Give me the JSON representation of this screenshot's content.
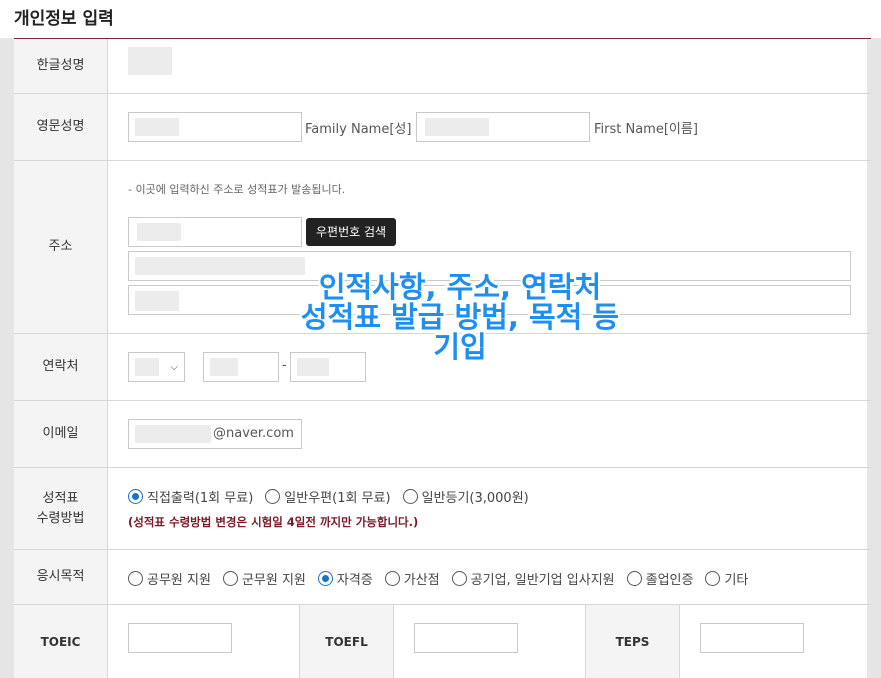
{
  "section": {
    "title": "개인정보 입력"
  },
  "rows": {
    "korean_name": {
      "label": "한글성명"
    },
    "english_name": {
      "label": "영문성명",
      "family_name_label": "Family Name[성]",
      "first_name_label": "First Name[이름]"
    },
    "address": {
      "label": "주소",
      "hint": "- 이곳에 입력하신 주소로 성적표가 발송됩니다.",
      "postcode_button": "우편번호 검색"
    },
    "contact": {
      "label": "연락처",
      "separator": "-"
    },
    "email": {
      "label": "이메일",
      "domain": "@naver.com"
    },
    "receipt": {
      "label_line1": "성적표",
      "label_line2": "수령방법",
      "options": [
        {
          "label": "직접출력(1회 무료)",
          "checked": true
        },
        {
          "label": "일반우편(1회 무료)",
          "checked": false
        },
        {
          "label": "일반등기(3,000원)",
          "checked": false
        }
      ],
      "note": "(성적표 수령방법 변경은 시험일 4일전 까지만 가능합니다.)"
    },
    "purpose": {
      "label": "응시목적",
      "options": [
        {
          "label": "공무원 지원",
          "checked": false
        },
        {
          "label": "군무원 지원",
          "checked": false
        },
        {
          "label": "자격증",
          "checked": true
        },
        {
          "label": "가산점",
          "checked": false
        },
        {
          "label": "공기업, 일반기업 입사지원",
          "checked": false
        },
        {
          "label": "졸업인증",
          "checked": false
        },
        {
          "label": "기타",
          "checked": false
        }
      ]
    },
    "scores": {
      "toeic": "TOEIC",
      "toefl": "TOEFL",
      "teps": "TEPS"
    }
  },
  "overlay": {
    "line1": "인적사항, 주소, 연락처",
    "line2": "성적표 발급 방법, 목적 등",
    "line3": "기입"
  },
  "colors": {
    "accent": "#1b6fd1",
    "overlay": "#1c8ff0",
    "title_line": "#7a2a3a",
    "note": "#7a1a2a"
  }
}
